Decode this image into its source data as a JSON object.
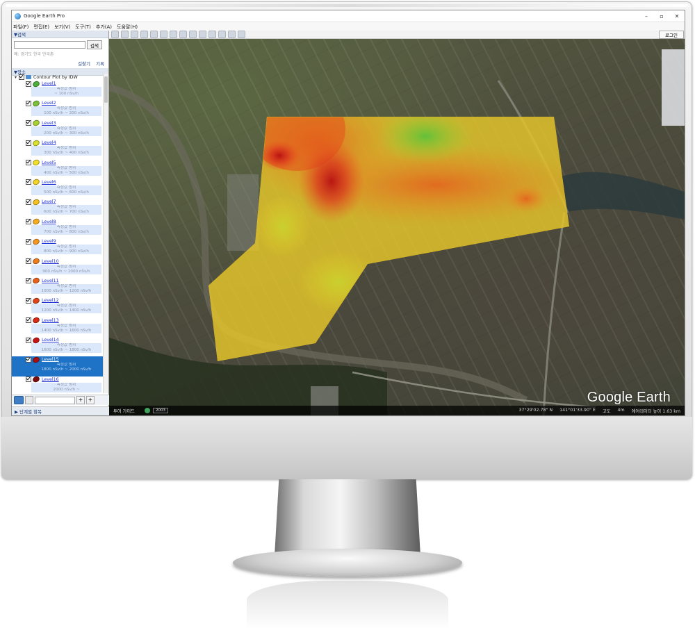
{
  "window": {
    "title": "Google Earth Pro",
    "min": "–",
    "max": "▫",
    "close": "✕"
  },
  "menu": [
    "파일(F)",
    "편집(E)",
    "보기(V)",
    "도구(T)",
    "추가(A)",
    "도움말(H)"
  ],
  "search": {
    "header": "▼검색",
    "placeholder": "",
    "button": "검색",
    "hint": "예: 경기도 한국 만국촌",
    "directions": "길찾기",
    "history": "기록"
  },
  "places": {
    "header": "▼장소",
    "root_label": "Contour Plot by IDW",
    "levels": [
      {
        "name": "Level1",
        "line1": "측정값 범위",
        "line2": "~ 100 nSv/h",
        "color": "#4caf3d"
      },
      {
        "name": "Level2",
        "line1": "측정값 범위",
        "line2": "100 nSv/h ~ 200 nSv/h",
        "color": "#7cc13a"
      },
      {
        "name": "Level3",
        "line1": "측정값 범위",
        "line2": "200 nSv/h ~ 300 nSv/h",
        "color": "#a8d234"
      },
      {
        "name": "Level4",
        "line1": "측정값 범위",
        "line2": "300 nSv/h ~ 400 nSv/h",
        "color": "#d7e02f"
      },
      {
        "name": "Level5",
        "line1": "측정값 범위",
        "line2": "400 nSv/h ~ 500 nSv/h",
        "color": "#f0e02a"
      },
      {
        "name": "Level6",
        "line1": "측정값 범위",
        "line2": "500 nSv/h ~ 600 nSv/h",
        "color": "#f4d427"
      },
      {
        "name": "Level7",
        "line1": "측정값 범위",
        "line2": "600 nSv/h ~ 700 nSv/h",
        "color": "#f6c223"
      },
      {
        "name": "Level8",
        "line1": "측정값 범위",
        "line2": "700 nSv/h ~ 800 nSv/h",
        "color": "#f5ad21"
      },
      {
        "name": "Level9",
        "line1": "측정값 범위",
        "line2": "800 nSv/h ~ 900 nSv/h",
        "color": "#f3961f"
      },
      {
        "name": "Level10",
        "line1": "측정값 범위",
        "line2": "900 nSv/h ~ 1000 nSv/h",
        "color": "#ee7b1c"
      },
      {
        "name": "Level11",
        "line1": "측정값 범위",
        "line2": "1000 nSv/h ~ 1200 nSv/h",
        "color": "#e8601a"
      },
      {
        "name": "Level12",
        "line1": "측정값 범위",
        "line2": "1200 nSv/h ~ 1400 nSv/h",
        "color": "#e04418"
      },
      {
        "name": "Level13",
        "line1": "측정값 범위",
        "line2": "1400 nSv/h ~ 1600 nSv/h",
        "color": "#d82a16"
      },
      {
        "name": "Level14",
        "line1": "측정값 범위",
        "line2": "1600 nSv/h ~ 1800 nSv/h",
        "color": "#c71414"
      },
      {
        "name": "Level15",
        "line1": "측정값 범위",
        "line2": "1800 nSv/h ~ 2000 nSv/h",
        "color": "#a80f0f",
        "selected": true
      },
      {
        "name": "Level16",
        "line1": "측정값 범위",
        "line2": "2000 nSv/h ~",
        "color": "#7f0c0c"
      }
    ]
  },
  "layers_header": "▶ 단계별 항목",
  "toolbar": {
    "login": "로그인"
  },
  "statusbar": {
    "tour_guide": "투어 가이드",
    "year": "2003",
    "lat": "37°29'02.78\" N",
    "lon": "141°01'33.90\" E",
    "elevation_label": "고도",
    "elevation": "4m",
    "eye": "에어데이터 높이 1.63 km"
  },
  "logo": "Google Earth"
}
